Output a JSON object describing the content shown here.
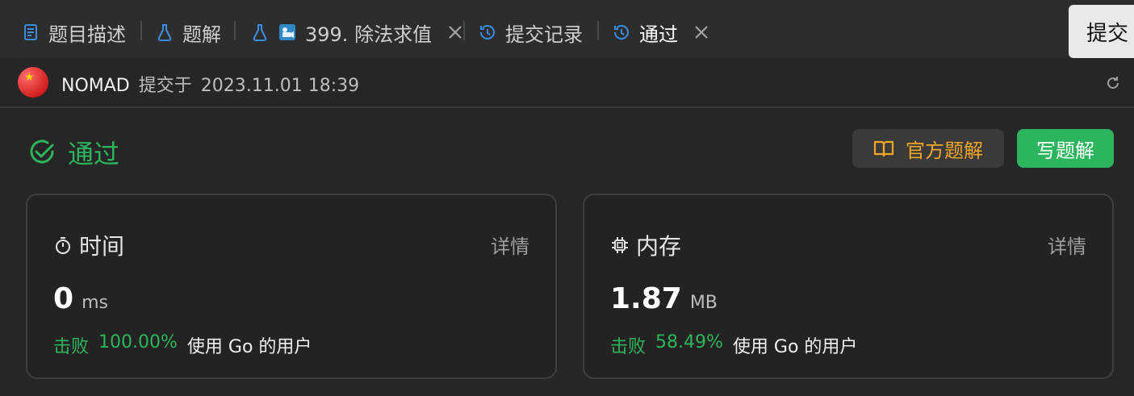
{
  "tabs": [
    {
      "label": "题目描述"
    },
    {
      "label": "题解"
    },
    {
      "label": "399. 除法求值"
    },
    {
      "label": "提交记录"
    },
    {
      "label": "通过"
    }
  ],
  "floating_button": {
    "label": "提交"
  },
  "submission": {
    "user": "NOMAD",
    "submitted_prefix": "提交于",
    "timestamp": "2023.11.01 18:39"
  },
  "status": {
    "label": "通过"
  },
  "buttons": {
    "official_solution": "官方题解",
    "write_solution": "写题解"
  },
  "metrics": {
    "time": {
      "title": "时间",
      "detail": "详情",
      "value": "0",
      "unit": "ms",
      "beats_prefix": "击败",
      "beats_percent": "100.00%",
      "beats_suffix": "使用 Go 的用户"
    },
    "memory": {
      "title": "内存",
      "detail": "详情",
      "value": "1.87",
      "unit": "MB",
      "beats_prefix": "击败",
      "beats_percent": "58.49%",
      "beats_suffix": "使用 Go 的用户"
    }
  },
  "colors": {
    "accent_green": "#2db55d",
    "accent_orange": "#f5a623",
    "tab_blue": "#3a8ee6"
  },
  "icons": {
    "tab_description": "document-icon",
    "tab_solution": "flask-icon",
    "tab_problem": "flask-icon",
    "tab_problem_extra": "video-icon",
    "tab_submissions": "history-icon",
    "tab_passed": "history-icon",
    "close": "close-icon",
    "status": "check-circle-icon",
    "official": "book-icon",
    "time": "stopwatch-icon",
    "memory": "chip-icon",
    "reload": "refresh-icon"
  }
}
